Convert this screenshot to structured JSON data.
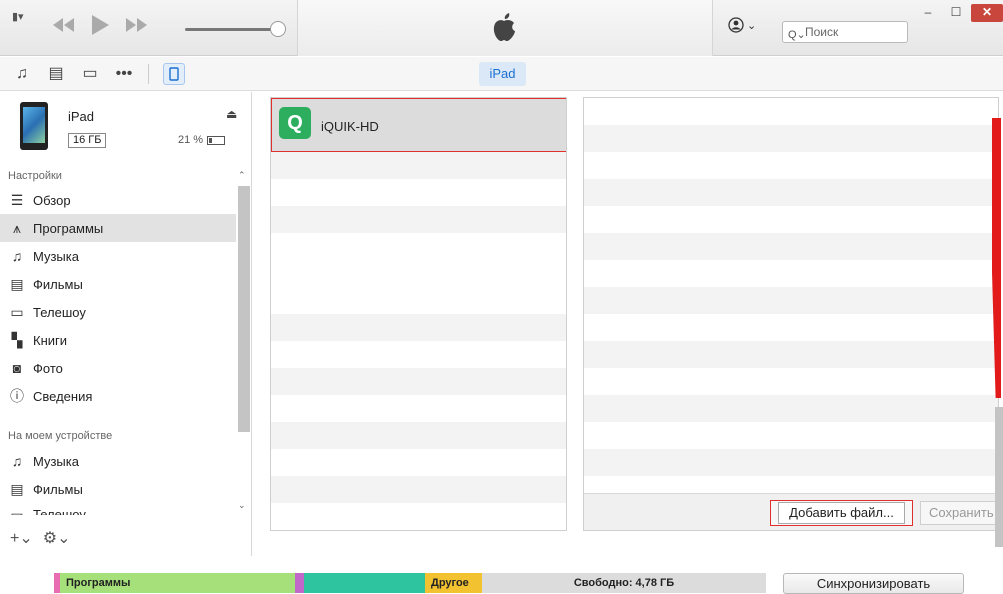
{
  "titlebar": {
    "search_placeholder": "Поиск",
    "window_buttons": [
      "–",
      "☐",
      "✕"
    ]
  },
  "toolbar": {
    "device_tab": "iPad"
  },
  "device": {
    "name": "iPad",
    "capacity": "16 ГБ",
    "battery": "21 %"
  },
  "sidebar": {
    "settings_header": "Настройки",
    "settings_items": [
      {
        "label": "Обзор",
        "icon": "summary-icon"
      },
      {
        "label": "Программы",
        "icon": "apps-icon",
        "selected": true
      },
      {
        "label": "Музыка",
        "icon": "music-icon"
      },
      {
        "label": "Фильмы",
        "icon": "film-icon"
      },
      {
        "label": "Телешоу",
        "icon": "tv-icon"
      },
      {
        "label": "Книги",
        "icon": "books-icon"
      },
      {
        "label": "Фото",
        "icon": "camera-icon"
      },
      {
        "label": "Сведения",
        "icon": "info-icon"
      }
    ],
    "device_header": "На моем устройстве",
    "device_items": [
      {
        "label": "Музыка",
        "icon": "music-icon"
      },
      {
        "label": "Фильмы",
        "icon": "film-icon"
      },
      {
        "label": "Телешоу",
        "icon": "tv-icon"
      }
    ]
  },
  "apps": {
    "items": [
      {
        "label": "iQUIK-HD",
        "icon_text": "Q"
      }
    ]
  },
  "documents": {
    "add_button": "Добавить файл...",
    "save_button": "Сохранить"
  },
  "storage": {
    "segments": [
      {
        "label": "",
        "color": "#e86cb0",
        "fraction": 0.006
      },
      {
        "label": "Программы",
        "color": "#a6e07a",
        "fraction": 0.33
      },
      {
        "label": "",
        "color": "#c067c9",
        "fraction": 0.012
      },
      {
        "label": "",
        "color": "#2fc4a0",
        "fraction": 0.17
      },
      {
        "label": "Другое",
        "color": "#f2c230",
        "fraction": 0.08
      },
      {
        "label": "Свободно: 4,78 ГБ",
        "color": "#dcdcdc",
        "fraction": 0.402
      }
    ],
    "sync_button": "Синхронизировать"
  }
}
